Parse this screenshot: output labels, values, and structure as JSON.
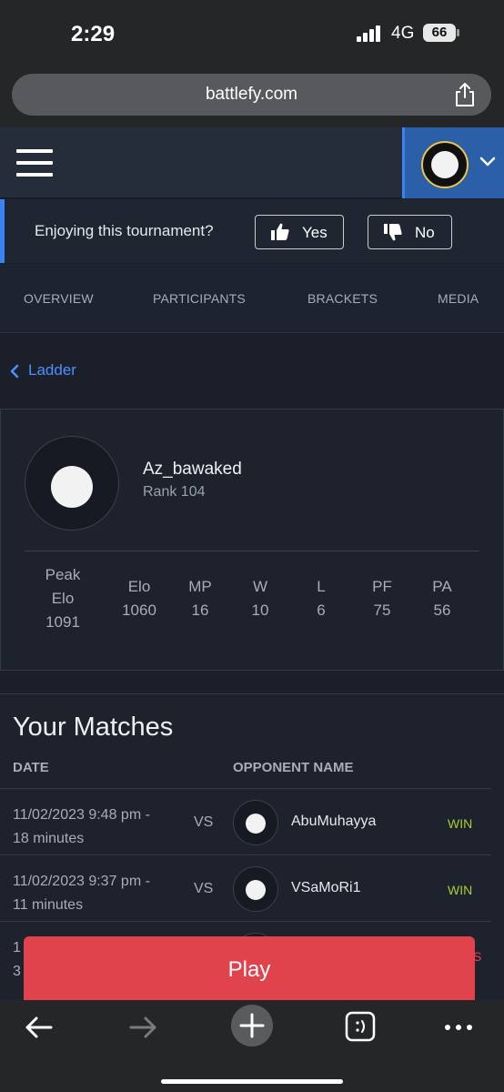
{
  "status_bar": {
    "time": "2:29",
    "network": "4G",
    "battery": "66"
  },
  "browser": {
    "url": "battlefy.com"
  },
  "feedback": {
    "question": "Enjoying this tournament?",
    "yes_label": "Yes",
    "no_label": "No"
  },
  "tabs": [
    "OVERVIEW",
    "PARTICIPANTS",
    "BRACKETS",
    "MEDIA"
  ],
  "breadcrumb": {
    "back_label": "Ladder"
  },
  "profile": {
    "username": "Az_bawaked",
    "rank": "Rank 104",
    "stats": [
      {
        "label_line1": "Peak",
        "label_line2": "Elo",
        "value": "1091"
      },
      {
        "label": "Elo",
        "value": "1060"
      },
      {
        "label": "MP",
        "value": "16"
      },
      {
        "label": "W",
        "value": "10"
      },
      {
        "label": "L",
        "value": "6"
      },
      {
        "label": "PF",
        "value": "75"
      },
      {
        "label": "PA",
        "value": "56"
      }
    ]
  },
  "matches": {
    "title": "Your Matches",
    "col_date": "DATE",
    "col_opponent": "OPPONENT NAME",
    "rows": [
      {
        "date_line1": "11/02/2023 9:48 pm -",
        "date_line2": "18 minutes",
        "vs": "VS",
        "opponent": "AbuMuhayya",
        "result": "WIN"
      },
      {
        "date_line1": "11/02/2023 9:37 pm -",
        "date_line2": "11 minutes",
        "vs": "VS",
        "opponent": "VSaMoRi1",
        "result": "WIN"
      },
      {
        "date_line1": "1",
        "date_line2": "3",
        "vs": "",
        "opponent": "",
        "result": "S"
      }
    ]
  },
  "play_button": {
    "label": "Play"
  },
  "colors": {
    "accent_blue": "#3b82f6",
    "win_green": "#a6cf2e",
    "play_red": "#e0434c"
  },
  "toolbar_icons": [
    "back-arrow-icon",
    "forward-arrow-icon",
    "new-tab-plus-icon",
    "tabs-icon",
    "more-icon"
  ]
}
